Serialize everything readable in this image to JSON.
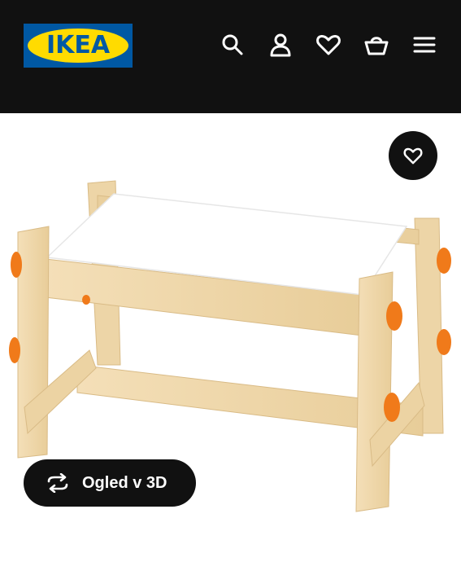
{
  "header": {
    "logo_text": "IKEA",
    "brand_colors": {
      "blue": "#0058a3",
      "yellow": "#ffdb00"
    },
    "background": "#111111",
    "icons": [
      "search-icon",
      "account-icon",
      "wishlist-icon",
      "cart-icon",
      "menu-icon"
    ]
  },
  "product": {
    "image_alt_name": "children-bench-image",
    "favorite_icon": "heart-icon"
  },
  "view_3d": {
    "label": "Ogled v 3D",
    "icon": "rotate-3d-icon"
  }
}
